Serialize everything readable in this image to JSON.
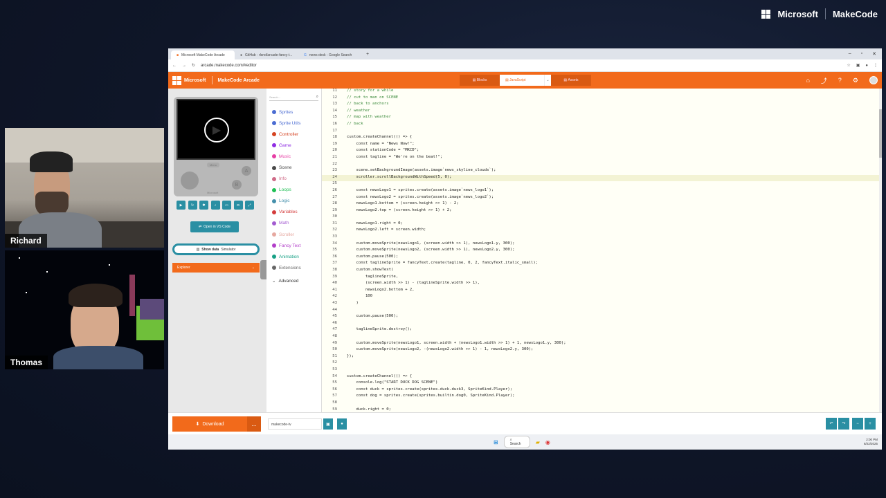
{
  "branding": {
    "microsoft": "Microsoft",
    "makecode": "MakeCode"
  },
  "webcams": [
    {
      "name": "Richard"
    },
    {
      "name": "Thomas"
    }
  ],
  "browser": {
    "tabs": [
      "Microsoft MakeCode Arcade",
      "GitHub - rlsnd/arcade-fancy-t...",
      "news desk - Google Search"
    ],
    "url": "arcade.makecode.com/#editor"
  },
  "app": {
    "brand": "Microsoft",
    "title": "MakeCode Arcade",
    "modes": {
      "blocks": "Blocks",
      "javascript": "JavaScript",
      "assets": "Assets"
    }
  },
  "simulator": {
    "menu": "Menu",
    "a": "A",
    "b": "B",
    "logo": "Microsoft",
    "open_vscode": "Open in VS Code",
    "show_data": "Show data",
    "show_data_suffix": "Simulator",
    "explorer": "Explorer"
  },
  "toolbox": {
    "search_placeholder": "Search...",
    "categories": [
      {
        "label": "Sprites",
        "color": "#4b6cd2"
      },
      {
        "label": "Sprite Utils",
        "color": "#4b6cd2"
      },
      {
        "label": "Controller",
        "color": "#d54322"
      },
      {
        "label": "Game",
        "color": "#8f2de3"
      },
      {
        "label": "Music",
        "color": "#e63da4"
      },
      {
        "label": "Scene",
        "color": "#4a4a4a"
      },
      {
        "label": "Info",
        "color": "#cf6a87"
      },
      {
        "label": "Loops",
        "color": "#20bf55"
      },
      {
        "label": "Logic",
        "color": "#458fab"
      },
      {
        "label": "Variables",
        "color": "#d43b3b"
      },
      {
        "label": "Math",
        "color": "#a35bd0"
      },
      {
        "label": "Scroller",
        "color": "#e6a8a0"
      },
      {
        "label": "Fancy Text",
        "color": "#b23ec9"
      },
      {
        "label": "Animation",
        "color": "#16a085"
      },
      {
        "label": "Extensions",
        "color": "#666666"
      }
    ],
    "advanced": "Advanced"
  },
  "editor": {
    "lines": [
      {
        "n": "11",
        "t": "// story for a while"
      },
      {
        "n": "12",
        "t": "// cut to man on SCENE"
      },
      {
        "n": "13",
        "t": "// back to anchors"
      },
      {
        "n": "14",
        "t": "// weather"
      },
      {
        "n": "15",
        "t": "// map with weather"
      },
      {
        "n": "16",
        "t": "// back"
      },
      {
        "n": "17",
        "t": ""
      },
      {
        "n": "18",
        "t": "custom.createChannel(() => {"
      },
      {
        "n": "19",
        "t": "    const name = \"News Now!\";"
      },
      {
        "n": "20",
        "t": "    const stationCode = \"MKCD\";"
      },
      {
        "n": "21",
        "t": "    const tagline = \"We're on the beat!\";"
      },
      {
        "n": "22",
        "t": ""
      },
      {
        "n": "23",
        "t": "    scene.setBackgroundImage(assets.image`news_skyline_clouds`);"
      },
      {
        "n": "24",
        "t": "    scroller.scrollBackgroundWithSpeed(5, 0);"
      },
      {
        "n": "25",
        "t": ""
      },
      {
        "n": "26",
        "t": "    const newsLogo1 = sprites.create(assets.image`news_logo1`);"
      },
      {
        "n": "27",
        "t": "    const newsLogo2 = sprites.create(assets.image`news_logo2`);"
      },
      {
        "n": "28",
        "t": "    newsLogo1.bottom = (screen.height >> 1) - 2;"
      },
      {
        "n": "29",
        "t": "    newsLogo2.top = (screen.height >> 1) + 2;"
      },
      {
        "n": "30",
        "t": ""
      },
      {
        "n": "31",
        "t": "    newsLogo1.right = 0;"
      },
      {
        "n": "32",
        "t": "    newsLogo2.left = screen.width;"
      },
      {
        "n": "33",
        "t": ""
      },
      {
        "n": "34",
        "t": "    custom.moveSprite(newsLogo1, (screen.width >> 1), newsLogo1.y, 300);"
      },
      {
        "n": "35",
        "t": "    custom.moveSprite(newsLogo2, (screen.width >> 1), newsLogo2.y, 300);"
      },
      {
        "n": "36",
        "t": "    custom.pause(500);"
      },
      {
        "n": "37",
        "t": "    const taglineSprite = fancyText.create(tagline, 0, 2, fancyText.italic_small);"
      },
      {
        "n": "38",
        "t": "    custom.showText("
      },
      {
        "n": "39",
        "t": "        taglineSprite,"
      },
      {
        "n": "40",
        "t": "        (screen.width >> 1) - (taglineSprite.width >> 1),"
      },
      {
        "n": "41",
        "t": "        newsLogo2.bottom + 2,"
      },
      {
        "n": "42",
        "t": "        100"
      },
      {
        "n": "43",
        "t": "    )"
      },
      {
        "n": "44",
        "t": ""
      },
      {
        "n": "45",
        "t": "    custom.pause(500);"
      },
      {
        "n": "46",
        "t": ""
      },
      {
        "n": "47",
        "t": "    taglineSprite.destroy();"
      },
      {
        "n": "48",
        "t": ""
      },
      {
        "n": "49",
        "t": "    custom.moveSprite(newsLogo1, screen.width + (newsLogo1.width >> 1) + 1, newsLogo1.y, 300);"
      },
      {
        "n": "50",
        "t": "    custom.moveSprite(newsLogo2, -(newsLogo2.width >> 1) - 1, newsLogo2.y, 300);"
      },
      {
        "n": "51",
        "t": "});"
      },
      {
        "n": "52",
        "t": ""
      },
      {
        "n": "53",
        "t": ""
      },
      {
        "n": "54",
        "t": "custom.createChannel(() => {"
      },
      {
        "n": "55",
        "t": "    console.log(\"START DUCK DOG SCENE\")"
      },
      {
        "n": "56",
        "t": "    const duck = sprites.create(sprites.duck.duck3, SpriteKind.Player);"
      },
      {
        "n": "57",
        "t": "    const dog = sprites.create(sprites.builtin.dog0, SpriteKind.Player);"
      },
      {
        "n": "58",
        "t": ""
      },
      {
        "n": "59",
        "t": "    duck.right = 0;"
      }
    ],
    "current_line": "24"
  },
  "footer": {
    "download": "Download",
    "more": "...",
    "project_name": "makecode-tv"
  },
  "taskbar": {
    "search": "Search",
    "time": "2:00 PM",
    "date": "8/22/2025"
  }
}
